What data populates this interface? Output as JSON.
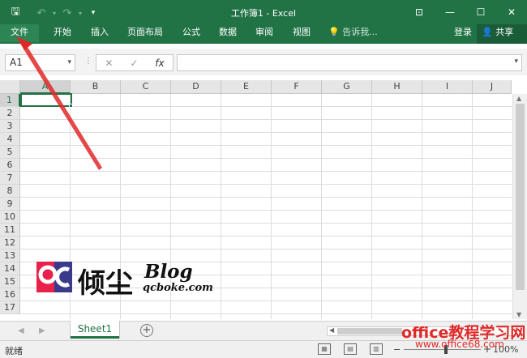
{
  "window": {
    "title": "工作簿1 - Excel",
    "qat": {
      "save_icon": "save-icon",
      "undo_icon": "undo-icon",
      "redo_icon": "redo-icon",
      "customize_icon": "customize-qat-icon"
    }
  },
  "ribbon": {
    "tabs": [
      "文件",
      "开始",
      "插入",
      "页面布局",
      "公式",
      "数据",
      "审阅",
      "视图"
    ],
    "tell_me": "告诉我...",
    "login": "登录",
    "share": "共享"
  },
  "formula_bar": {
    "name_box": "A1",
    "cancel_symbol": "✕",
    "enter_symbol": "✓",
    "fx_symbol": "fx",
    "formula_value": ""
  },
  "grid": {
    "columns": [
      "A",
      "B",
      "C",
      "D",
      "E",
      "F",
      "G",
      "H",
      "I",
      "J"
    ],
    "rows": [
      "1",
      "2",
      "3",
      "4",
      "5",
      "6",
      "7",
      "8",
      "9",
      "10",
      "11",
      "12",
      "13",
      "14",
      "15",
      "16",
      "17"
    ],
    "active_cell": "A1"
  },
  "sheets": {
    "tabs": [
      "Sheet1"
    ],
    "add_symbol": "+"
  },
  "status": {
    "text": "就绪",
    "zoom": "100%",
    "zoom_minus": "−",
    "zoom_plus": "+"
  },
  "watermark": {
    "site_name": "倾尘",
    "blog_word": "Blog",
    "blog_domain": "qcboke.com",
    "office_name": "office教程学习网",
    "office_url": "www.office68.com"
  },
  "colors": {
    "excel_green": "#217346",
    "annotation_red": "#e02828"
  }
}
